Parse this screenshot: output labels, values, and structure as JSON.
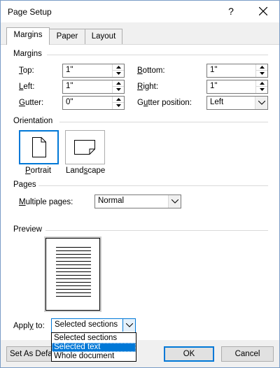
{
  "window": {
    "title": "Page Setup",
    "help": "?"
  },
  "tabs": [
    {
      "label": "Margins"
    },
    {
      "label": "Paper"
    },
    {
      "label": "Layout"
    }
  ],
  "margins": {
    "group_label": "Margins",
    "top": {
      "label_u": "T",
      "label_rest": "op:",
      "value": "1\""
    },
    "bottom": {
      "label_u": "B",
      "label_rest": "ottom:",
      "value": "1\""
    },
    "left": {
      "label_u": "L",
      "label_rest": "eft:",
      "value": "1\""
    },
    "right": {
      "label_u": "R",
      "label_rest": "ight:",
      "value": "1\""
    },
    "gutter": {
      "label_u": "G",
      "label_rest": "utter:",
      "value": "0\""
    },
    "gutter_position": {
      "label_pre": "G",
      "label_u": "u",
      "label_rest": "tter position:",
      "value": "Left"
    }
  },
  "orientation": {
    "group_label": "Orientation",
    "portrait": {
      "label_u": "P",
      "label_rest": "ortrait"
    },
    "landscape": {
      "label_u": "",
      "label_pre": "Land",
      "label_u2": "s",
      "label_rest": "cape"
    },
    "selected": "portrait"
  },
  "pages": {
    "group_label": "Pages",
    "multiple_pages": {
      "label_u": "M",
      "label_rest": "ultiple pages:",
      "value": "Normal"
    }
  },
  "preview": {
    "group_label": "Preview"
  },
  "apply_to": {
    "label_pre": "Appl",
    "label_u": "y",
    "label_rest": " to:",
    "value": "Selected sections",
    "options": [
      "Selected sections",
      "Selected text",
      "Whole document"
    ],
    "highlighted": "Selected text"
  },
  "footer": {
    "set_default_label": "Set As Defa",
    "ok_label": "OK",
    "cancel_label": "Cancel"
  },
  "colors": {
    "accent": "#0078d7",
    "selection_bg": "#0078d7"
  }
}
